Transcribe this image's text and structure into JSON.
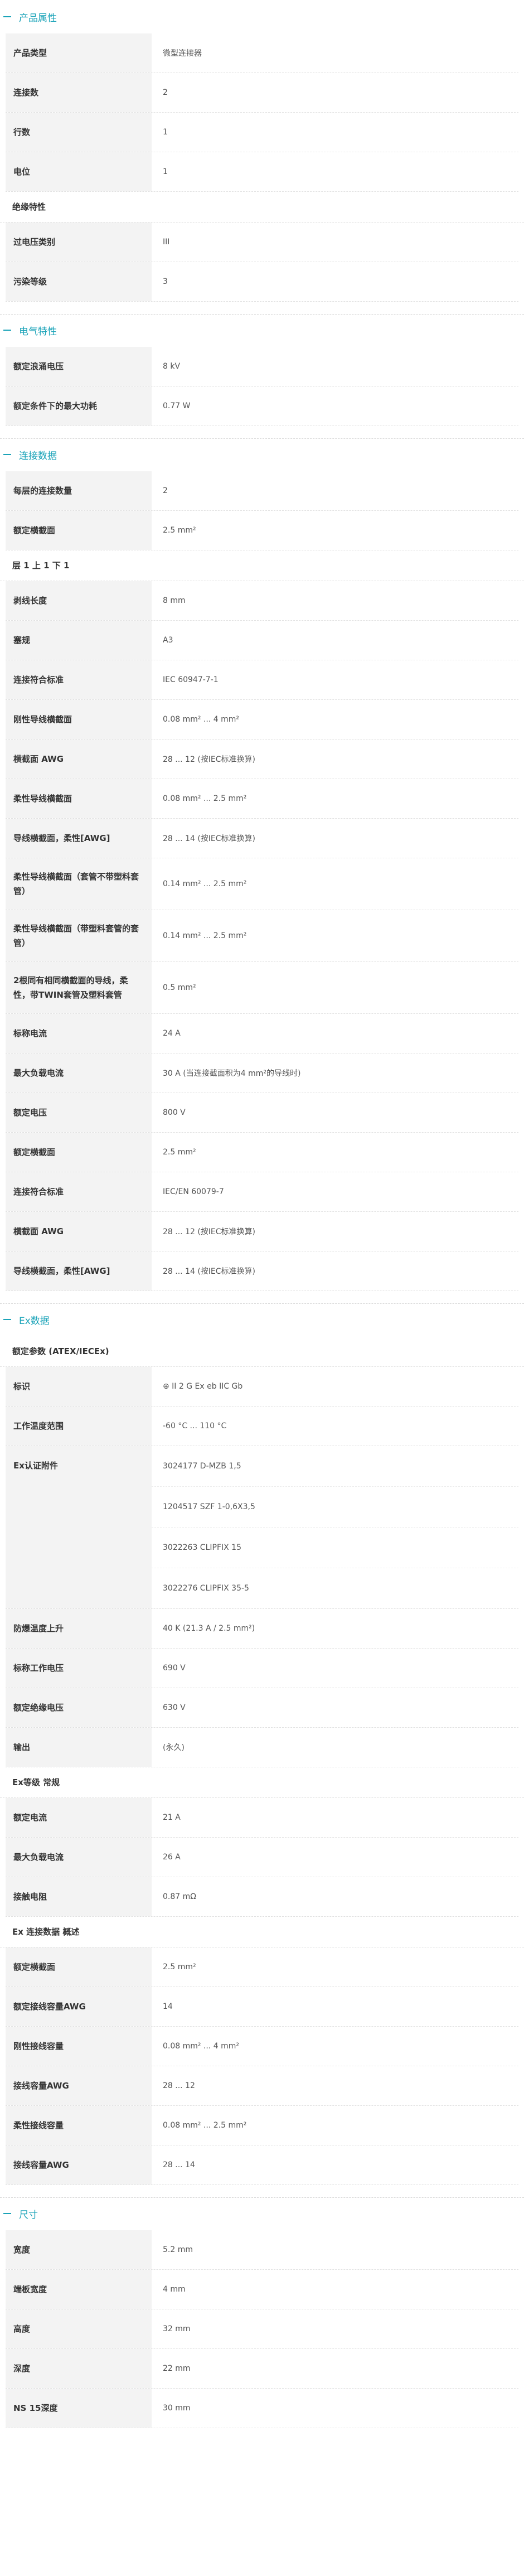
{
  "sections": {
    "product": {
      "title": "产品属性",
      "rows": [
        {
          "k": "产品类型",
          "v": "微型连接器"
        },
        {
          "k": "连接数",
          "v": "2"
        },
        {
          "k": "行数",
          "v": "1"
        },
        {
          "k": "电位",
          "v": "1"
        }
      ],
      "insulation_title": "绝缘特性",
      "insulation_rows": [
        {
          "k": "过电压类别",
          "v": "III"
        },
        {
          "k": "污染等级",
          "v": "3"
        }
      ]
    },
    "electrical": {
      "title": "电气特性",
      "rows": [
        {
          "k": "额定浪涌电压",
          "v": "8 kV"
        },
        {
          "k": "额定条件下的最大功耗",
          "v": "0.77 W"
        }
      ]
    },
    "connection": {
      "title": "连接数据",
      "rows": [
        {
          "k": "每层的连接数量",
          "v": "2"
        },
        {
          "k": "额定横截面",
          "v": "2.5 mm²"
        }
      ],
      "level_title": "层 1 上 1 下 1",
      "level_rows": [
        {
          "k": "剥线长度",
          "v": "8 mm"
        },
        {
          "k": "塞规",
          "v": "A3"
        },
        {
          "k": "连接符合标准",
          "v": "IEC 60947-7-1"
        },
        {
          "k": "刚性导线横截面",
          "v": "0.08 mm² ... 4 mm²"
        },
        {
          "k": "横截面 AWG",
          "v": "28 ... 12 (按IEC标准换算)"
        },
        {
          "k": "柔性导线横截面",
          "v": "0.08 mm² ... 2.5 mm²"
        },
        {
          "k": "导线横截面，柔性[AWG]",
          "v": "28 ... 14 (按IEC标准换算)"
        },
        {
          "k": "柔性导线横截面（套管不带塑料套管）",
          "v": "0.14 mm² ... 2.5 mm²",
          "tall": true
        },
        {
          "k": "柔性导线横截面（带塑料套管的套管）",
          "v": "0.14 mm² ... 2.5 mm²",
          "tall": true
        },
        {
          "k": "2根同有相同横截面的导线，柔性，带TWIN套管及塑料套管",
          "v": "0.5 mm²",
          "tall": true
        },
        {
          "k": "标称电流",
          "v": "24 A"
        },
        {
          "k": "最大负载电流",
          "v": "30 A (当连接截面积为4 mm²的导线时)"
        },
        {
          "k": "额定电压",
          "v": "800 V"
        },
        {
          "k": "额定横截面",
          "v": "2.5 mm²"
        },
        {
          "k": "连接符合标准",
          "v": "IEC/EN 60079-7"
        },
        {
          "k": "横截面 AWG",
          "v": "28 ... 12 (按IEC标准换算)"
        },
        {
          "k": "导线横截面，柔性[AWG]",
          "v": "28 ... 14 (按IEC标准换算)"
        }
      ]
    },
    "ex": {
      "title": "Ex数据",
      "params_title": "额定参数 (ATEX/IECEx)",
      "rows_a": [
        {
          "k": "标识",
          "v": "⊕ II 2 G Ex eb IIC Gb"
        },
        {
          "k": "工作温度范围",
          "v": "-60 °C ... 110 °C"
        }
      ],
      "cert_key": "Ex认证附件",
      "cert_values": [
        "3024177 D-MZB 1,5",
        "1204517 SZF 1-0,6X3,5",
        "3022263 CLIPFIX 15",
        "3022276 CLIPFIX 35-5"
      ],
      "rows_b": [
        {
          "k": "防爆温度上升",
          "v": "40 K (21.3 A / 2.5 mm²)"
        },
        {
          "k": "标称工作电压",
          "v": "690 V"
        },
        {
          "k": "额定绝缘电压",
          "v": "630 V"
        },
        {
          "k": "输出",
          "v": "(永久)"
        }
      ],
      "normal_title": "Ex等级 常规",
      "normal_rows": [
        {
          "k": "额定电流",
          "v": "21 A"
        },
        {
          "k": "最大负载电流",
          "v": "26 A"
        },
        {
          "k": "接触电阻",
          "v": "0.87 mΩ"
        }
      ],
      "conn_title": "Ex 连接数据 概述",
      "conn_rows": [
        {
          "k": "额定横截面",
          "v": "2.5 mm²"
        },
        {
          "k": "额定接线容量AWG",
          "v": "14"
        },
        {
          "k": "刚性接线容量",
          "v": "0.08 mm² ... 4 mm²"
        },
        {
          "k": "接线容量AWG",
          "v": "28 ... 12"
        },
        {
          "k": "柔性接线容量",
          "v": "0.08 mm² ... 2.5 mm²"
        },
        {
          "k": "接线容量AWG",
          "v": "28 ... 14"
        }
      ]
    },
    "dimensions": {
      "title": "尺寸",
      "rows": [
        {
          "k": "宽度",
          "v": "5.2 mm"
        },
        {
          "k": "端板宽度",
          "v": "4 mm"
        },
        {
          "k": "高度",
          "v": "32 mm"
        },
        {
          "k": "深度",
          "v": "22 mm"
        },
        {
          "k": "NS 15深度",
          "v": "30 mm"
        }
      ]
    }
  },
  "colors": {
    "accent": "#1aa3b8",
    "key_bg": "#f3f3f3"
  }
}
